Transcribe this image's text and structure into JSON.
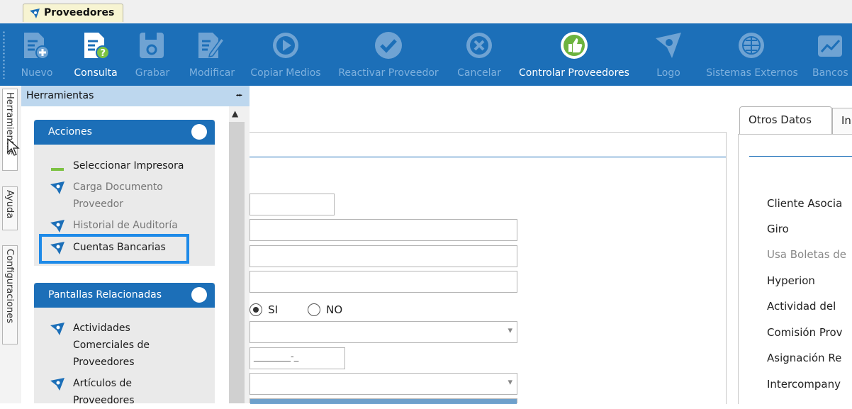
{
  "tab": {
    "label": "Proveedores"
  },
  "toolbar": {
    "buttons": [
      {
        "label": "Nuevo",
        "icon": "new-document-icon",
        "enabled": false
      },
      {
        "label": "Consulta",
        "icon": "query-document-icon",
        "enabled": true
      },
      {
        "label": "Grabar",
        "icon": "save-disk-icon",
        "enabled": false
      },
      {
        "label": "Modificar",
        "icon": "edit-document-icon",
        "enabled": false
      },
      {
        "label": "Copiar Medios",
        "icon": "play-circle-icon",
        "enabled": false
      },
      {
        "label": "Reactivar Proveedor",
        "icon": "check-circle-icon",
        "enabled": false
      },
      {
        "label": "Cancelar",
        "icon": "x-circle-icon",
        "enabled": false
      },
      {
        "label": "Controlar Proveedores",
        "icon": "thumbs-up-icon",
        "enabled": true
      },
      {
        "label": "Logo",
        "icon": "logo-icon",
        "enabled": false
      },
      {
        "label": "Sistemas Externos",
        "icon": "globe-icon",
        "enabled": false
      },
      {
        "label": "Bancos",
        "icon": "trend-chart-icon",
        "enabled": false
      }
    ]
  },
  "side_tabs": [
    "Herramientas",
    "Ayuda",
    "Configuraciones"
  ],
  "tools": {
    "title": "Herramientas",
    "acciones": {
      "title": "Acciones",
      "items": [
        {
          "label": "Seleccionar Impresora"
        },
        {
          "label": "Carga Documento Proveedor"
        },
        {
          "label": "Historial de Auditoría"
        },
        {
          "label": "Cuentas Bancarias"
        }
      ]
    },
    "relacionadas": {
      "title": "Pantallas Relacionadas",
      "items": [
        {
          "label": "Actividades Comerciales de Proveedores"
        },
        {
          "label": "Artículos de Proveedores"
        }
      ]
    }
  },
  "form": {
    "radio_si": "SI",
    "radio_no": "NO",
    "masked_value": "________-_"
  },
  "otros": {
    "tab_label": "Otros Datos",
    "tab2_label": "In",
    "labels": [
      "Cliente Asocia",
      "Giro",
      "Usa Boletas de",
      "Hyperion",
      "Actividad del",
      "Comisión Prov",
      "Asignación Re",
      "Intercompany"
    ]
  },
  "colors": {
    "toolbar": "#1c6fb8",
    "highlight": "#1e8ae8",
    "panel_header": "#bdd7ee"
  }
}
